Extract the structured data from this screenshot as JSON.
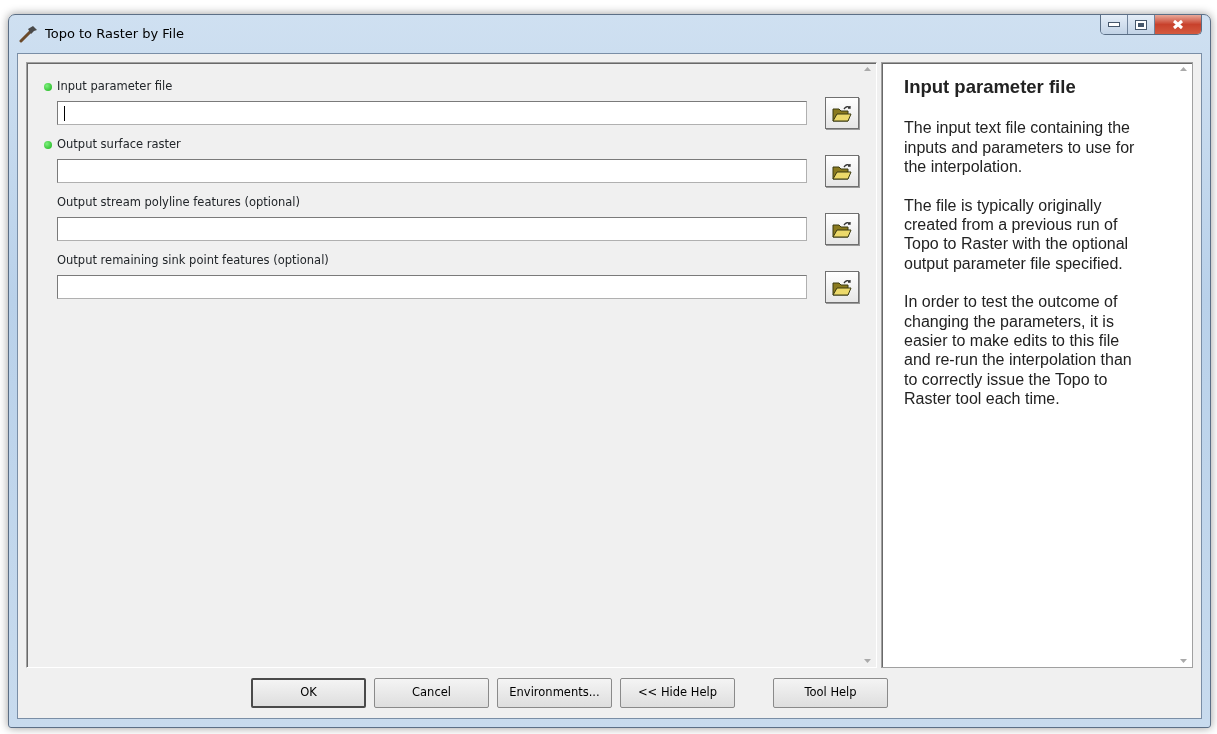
{
  "window": {
    "title": "Topo to Raster by File"
  },
  "parameters": [
    {
      "label": "Input parameter file",
      "required": true,
      "focused": true
    },
    {
      "label": "Output surface raster",
      "required": true,
      "focused": false
    },
    {
      "label": "Output stream polyline features (optional)",
      "required": false,
      "focused": false
    },
    {
      "label": "Output remaining sink point features (optional)",
      "required": false,
      "focused": false
    }
  ],
  "help": {
    "title": "Input parameter file",
    "paragraphs": [
      "The input text file containing the inputs and parameters to use for the interpolation.",
      "The file is typically originally created from a previous run of Topo to Raster with the optional output parameter file specified.",
      "In order to test the outcome of changing the parameters, it is easier to make edits to this file and re-run the interpolation than to correctly issue the Topo to Raster tool each time."
    ]
  },
  "buttons": [
    {
      "label": "OK",
      "kind": "default"
    },
    {
      "label": "Cancel",
      "kind": "normal"
    },
    {
      "label": "Environments...",
      "kind": "normal"
    },
    {
      "label": "<< Hide Help",
      "kind": "normal"
    },
    {
      "label": "Tool Help",
      "kind": "separated"
    }
  ]
}
